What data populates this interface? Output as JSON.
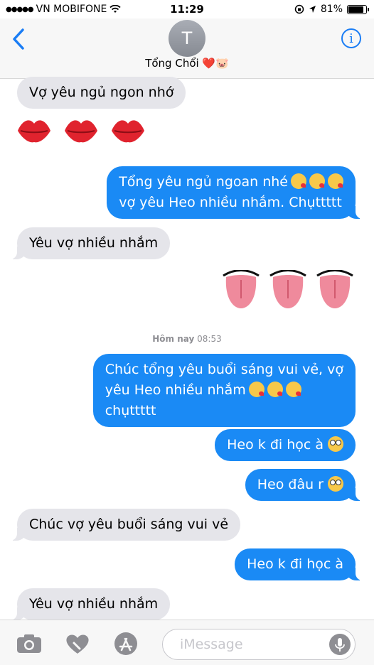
{
  "status_bar": {
    "signal_dots": "●●●●●",
    "carrier": "VN MOBIFONE",
    "time": "11:29",
    "battery_text": "81%",
    "battery_level": 0.81
  },
  "nav": {
    "avatar_initial": "T",
    "contact_name": "Tổng Chổi ❤️🐷",
    "info_label": "i"
  },
  "messages": [
    {
      "side": "in",
      "text": "Vợ yêu ngủ ngon nhớ"
    },
    {
      "side": "in",
      "type": "emoji",
      "icon": "kiss-mark",
      "count": 3
    },
    {
      "side": "out",
      "lines": [
        "Tổng yêu ngủ ngoan nhé",
        "vợ yêu Heo nhiều nhắm. Chụttttt"
      ],
      "emoji_icon": "face-blowing-kiss",
      "emoji_count": 3
    },
    {
      "side": "in",
      "text": "Yêu vợ nhiều nhắm"
    },
    {
      "side": "out",
      "type": "emoji",
      "icon": "tongue",
      "count": 3
    },
    {
      "side": "out",
      "lines": [
        "Chúc tổng yêu buổi sáng vui vẻ, vợ",
        "yêu Heo nhiều nhắm",
        "chụttttt"
      ],
      "emoji_icon": "face-blowing-kiss",
      "emoji_count": 3
    },
    {
      "side": "out",
      "text": "Heo k đi học à",
      "emoji_icon": "flushed-face"
    },
    {
      "side": "out",
      "text": "Heo đâu r",
      "emoji_icon": "flushed-face"
    },
    {
      "side": "in",
      "text": "Chúc vợ yêu buổi sáng vui vẻ"
    },
    {
      "side": "out",
      "text": "Heo k đi học à"
    },
    {
      "side": "in",
      "text": "Yêu vợ nhiều nhắm"
    }
  ],
  "timestamp": {
    "day": "Hôm nay",
    "time": "08:53"
  },
  "input_bar": {
    "placeholder": "iMessage",
    "icons": [
      "camera-icon",
      "digital-touch-heart-icon",
      "app-store-icon",
      "microphone-icon"
    ]
  },
  "colors": {
    "outgoing": "#1a8af5",
    "incoming": "#e5e5ea",
    "accent": "#1a7df5"
  }
}
